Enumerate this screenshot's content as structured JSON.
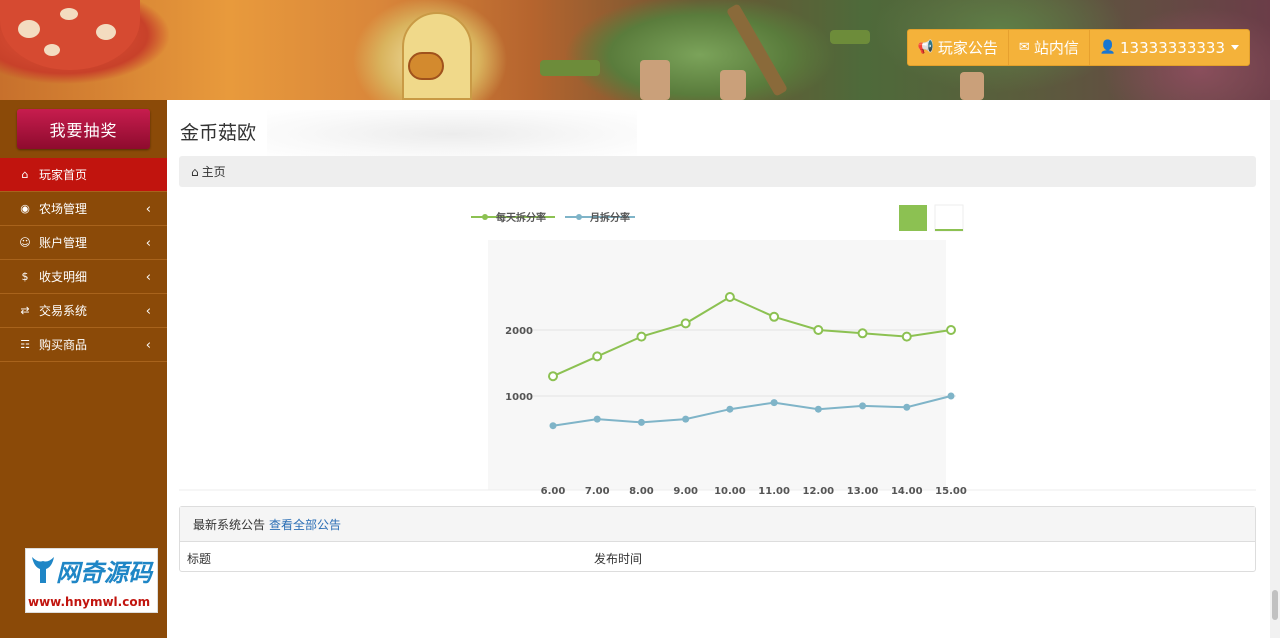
{
  "header": {
    "nav": [
      {
        "icon": "bullhorn-icon",
        "label": "玩家公告"
      },
      {
        "icon": "envelope-icon",
        "label": "站内信"
      },
      {
        "icon": "user-icon",
        "label": "13333333333"
      }
    ]
  },
  "sidebar": {
    "lottery_label": "我要抽奖",
    "items": [
      {
        "icon": "home-icon",
        "label": "玩家首页",
        "active": true
      },
      {
        "icon": "piggy-bank-icon",
        "label": "农场管理",
        "active": false
      },
      {
        "icon": "user-icon",
        "label": "账户管理",
        "active": false
      },
      {
        "icon": "dollar-icon",
        "label": "收支明细",
        "active": false
      },
      {
        "icon": "retweet-icon",
        "label": "交易系统",
        "active": false
      },
      {
        "icon": "shopping-cart-icon",
        "label": "购买商品",
        "active": false
      }
    ],
    "logo": {
      "text": "网奇源码",
      "url": "www.hnymwl.com"
    }
  },
  "main": {
    "title": "金币菇欧",
    "breadcrumb": "主页",
    "announce": {
      "heading": "最新系统公告",
      "link": "查看全部公告",
      "columns": [
        "标题",
        "发布时间"
      ]
    }
  },
  "chart_data": {
    "type": "line",
    "categories": [
      "6.00",
      "7.00",
      "8.00",
      "9.00",
      "10.00",
      "11.00",
      "12.00",
      "13.00",
      "14.00",
      "15.00"
    ],
    "series": [
      {
        "name": "每天拆分率",
        "color": "#8cc152",
        "values": [
          1300,
          1600,
          1900,
          2100,
          2500,
          2200,
          2000,
          1950,
          1900,
          2000
        ]
      },
      {
        "name": "月拆分率",
        "color": "#7fb4c8",
        "values": [
          550,
          650,
          600,
          650,
          800,
          900,
          800,
          850,
          830,
          1000
        ]
      }
    ],
    "y_ticks": [
      1000,
      2000
    ],
    "ylim": [
      0,
      3000
    ],
    "legend": "top-center",
    "grid": true
  }
}
